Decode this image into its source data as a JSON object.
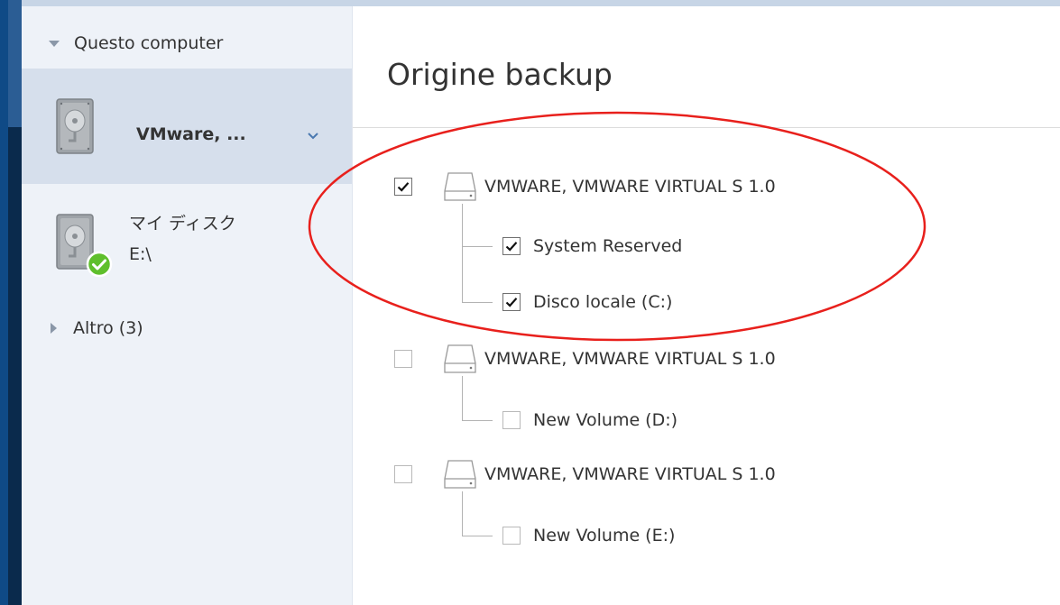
{
  "sidebar": {
    "this_computer_label": "Questo computer",
    "other_label": "Altro (3)",
    "sources": [
      {
        "name": "VMware, ...",
        "selected": true
      },
      {
        "name": "マイ ディスク",
        "path": "E:\\",
        "status": "ok"
      }
    ]
  },
  "main": {
    "title": "Origine backup",
    "disks": [
      {
        "label": "VMWARE, VMWARE VIRTUAL S 1.0",
        "checked": true,
        "volumes": [
          {
            "label": "System Reserved",
            "checked": true
          },
          {
            "label": "Disco locale (C:)",
            "checked": true
          }
        ]
      },
      {
        "label": "VMWARE, VMWARE VIRTUAL S 1.0",
        "checked": false,
        "volumes": [
          {
            "label": "New Volume (D:)",
            "checked": false
          }
        ]
      },
      {
        "label": "VMWARE, VMWARE VIRTUAL S 1.0",
        "checked": false,
        "volumes": [
          {
            "label": "New Volume (E:)",
            "checked": false
          }
        ]
      }
    ]
  },
  "icons": {
    "hdd": "hard-disk-icon",
    "status_ok": "check-circle-icon",
    "disk": "disk-drive-icon",
    "expand": "chevron-down-icon"
  },
  "colors": {
    "sidebar_bg": "#eef2f8",
    "selected_bg": "#d6dfec",
    "status_ok": "#5fbf2c",
    "annotation": "#e8201c"
  }
}
